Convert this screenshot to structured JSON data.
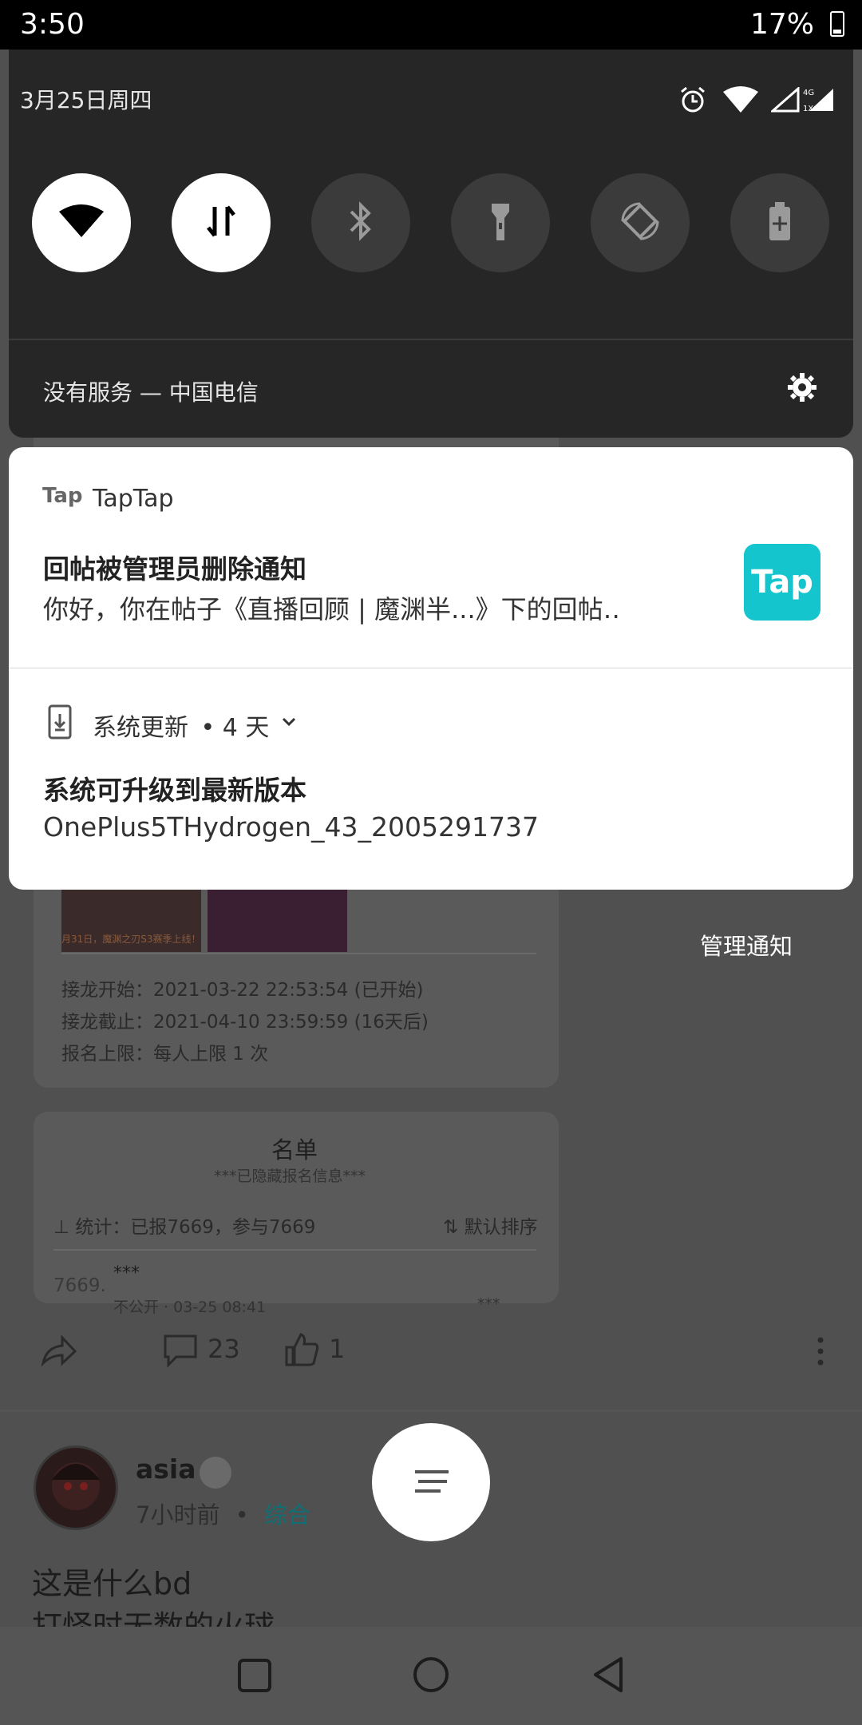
{
  "status_bar": {
    "time": "3:50",
    "battery": "17%"
  },
  "quick_settings": {
    "date": "3月25日周四",
    "tiles": [
      "wifi-icon",
      "mobile-data-icon",
      "bluetooth-icon",
      "flashlight-icon",
      "auto-rotate-icon",
      "battery-saver-icon"
    ],
    "carrier": "没有服务 — 中国电信"
  },
  "notifications": [
    {
      "app": "TapTap",
      "app_logo": "Tap",
      "title": "回帖被管理员删除通知",
      "text": "你好，你在帖子《直播回顾 | 魔渊半...》下的回帖‥",
      "large_icon": "Tap"
    },
    {
      "app": "系统更新",
      "time": "• 4 天",
      "title": "系统可升级到最新版本",
      "text": "OnePlus5THydrogen_43_2005291737"
    }
  ],
  "manage_notifications": "管理通知",
  "background_app": {
    "banner_text": "月31日，魔渊之刃S3赛季上线！",
    "info_rows": [
      "接龙开始：2021-03-22 22:53:54 (已开始)",
      "接龙截止：2021-04-10 23:59:59 (16天后)",
      "报名上限：每人上限 1 次"
    ],
    "list_title": "名单",
    "list_subtitle": "***已隐藏报名信息***",
    "stats": "统计：已报7669，参与7669",
    "sort": "默认排序",
    "entry_index": "7669.",
    "entry_name": "***",
    "entry_meta": "不公开 · 03-25 08:41",
    "entry_right": "***",
    "comment_count": "23",
    "like_count": "1",
    "author": "asia",
    "post_time": "7小时前",
    "post_dot": "•",
    "post_tag": "综合",
    "post_line1": "这是什么bd",
    "post_line2": "打怪时无数的火球"
  }
}
